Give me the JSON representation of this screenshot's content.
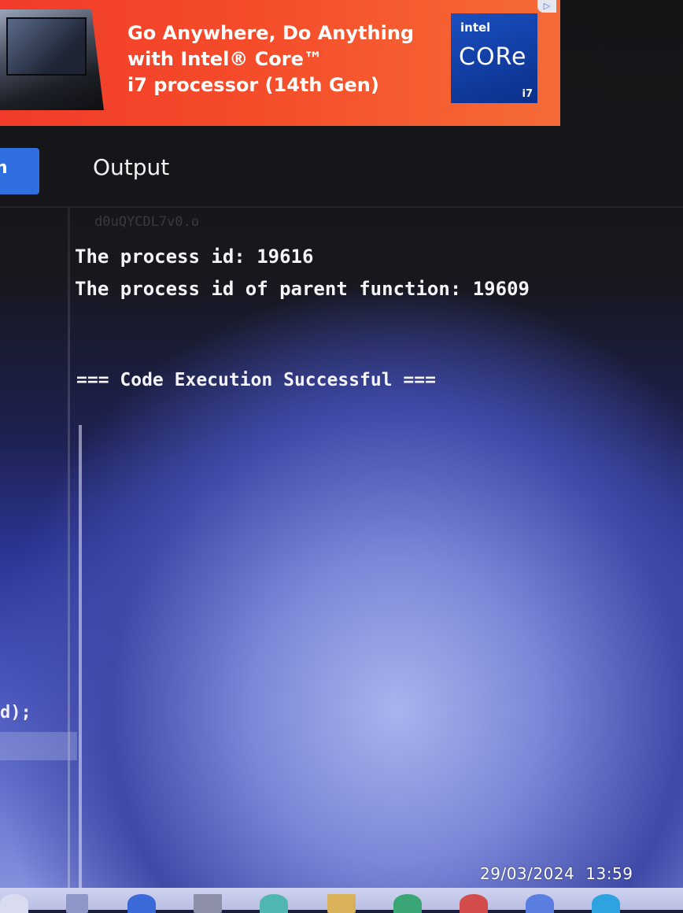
{
  "ad": {
    "line1": "Go Anywhere, Do Anything",
    "line2": "with Intel® Core™",
    "line3": "i7 processor (14th Gen)",
    "badge_brand": "intel",
    "badge_product": "CORe",
    "badge_tier": "i7",
    "ad_choices_icon": "ad-choices-icon"
  },
  "sidebar": {
    "run_tab_label": "n"
  },
  "output_panel": {
    "title": "Output",
    "faded_file_line": "d0uQYCDL7v0.o",
    "lines": [
      "The process id: 19616",
      "The process id of parent function: 19609"
    ],
    "status": "=== Code Execution Successful ==="
  },
  "editor": {
    "code_fragment": "d);"
  },
  "overlay": {
    "date": "29/03/2024",
    "time": "13:59"
  },
  "colors": {
    "ad_red": "#f23b2a",
    "run_tab_blue": "#2f6fe0",
    "intel_blue": "#1a4fc0"
  }
}
